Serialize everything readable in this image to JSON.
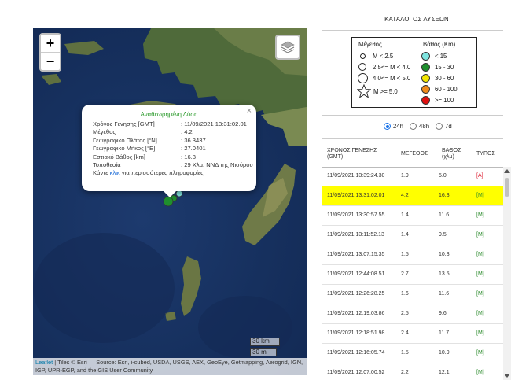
{
  "catalog_title": "ΚΑΤΑΛΟΓΟΣ ΛΥΣΕΩΝ",
  "map": {
    "zoom_in": "+",
    "zoom_out": "−",
    "scale_km": "30 km",
    "scale_mi": "30 mi",
    "attribution_leaflet": "Leaflet",
    "attribution_text": " | Tiles © Esri — Source: Esri, i-cubed, USDA, USGS, AEX, GeoEye, Getmapping, Aerogrid, IGN, IGP, UPR-EGP, and the GIS User Community"
  },
  "popup": {
    "title": "Αναθεωρημένη Λύση",
    "close": "×",
    "fields": [
      {
        "k": "Χρόνος Γένησης [GMT]",
        "v": ": 11/09/2021 13:31:02.01"
      },
      {
        "k": "Μέγεθος",
        "v": ": 4.2"
      },
      {
        "k": "Γεωγραφικό Πλάτος [°N]",
        "v": ": 36.3437"
      },
      {
        "k": "Γεωγραφικό Μήκος [°E]",
        "v": ": 27.0401"
      },
      {
        "k": "Εστιακό Βάθος [km]",
        "v": ": 16.3"
      },
      {
        "k": "Τοποθεσία",
        "v": ": 29 Χλμ. ΝΝΔ της Νισύρου"
      }
    ],
    "more_pre": "Κάντε ",
    "more_link": "κλικ",
    "more_post": " για περισσότερες πληροφορίες"
  },
  "legend": {
    "mag_header": "Μέγεθος",
    "mag_items": [
      "M < 2.5",
      "2.5<= M < 4.0",
      "4.0<= M < 5.0",
      "M >= 5.0"
    ],
    "depth_header": "Βάθος (Km)",
    "depth_items": [
      {
        "label": "< 15",
        "color": "#7fe5e0"
      },
      {
        "label": "15 - 30",
        "color": "#1f8f2e"
      },
      {
        "label": "30 - 60",
        "color": "#f2e600"
      },
      {
        "label": "60 - 100",
        "color": "#f08a1a"
      },
      {
        "label": ">= 100",
        "color": "#e01010"
      }
    ]
  },
  "filters": {
    "opt1": "24h",
    "opt2": "48h",
    "opt3": "7d",
    "selected": "24h"
  },
  "table": {
    "headers": {
      "time_l1": "ΧΡΟΝΟΣ ΓΕΝΕΣΗΣ",
      "time_l2": "(GMT)",
      "mag": "ΜΕΓΕΘΟΣ",
      "depth_l1": "ΒΑΘΟΣ",
      "depth_l2": "(χλμ)",
      "type": "ΤΥΠΟΣ"
    },
    "rows": [
      {
        "time": "11/09/2021 13:39:24.30",
        "mag": "1.9",
        "depth": "5.0",
        "type": "[A]"
      },
      {
        "time": "11/09/2021 13:31:02.01",
        "mag": "4.2",
        "depth": "16.3",
        "type": "[M]"
      },
      {
        "time": "11/09/2021 13:30:57.55",
        "mag": "1.4",
        "depth": "11.6",
        "type": "[M]"
      },
      {
        "time": "11/09/2021 13:11:52.13",
        "mag": "1.4",
        "depth": "9.5",
        "type": "[M]"
      },
      {
        "time": "11/09/2021 13:07:15.35",
        "mag": "1.5",
        "depth": "10.3",
        "type": "[M]"
      },
      {
        "time": "11/09/2021 12:44:08.51",
        "mag": "2.7",
        "depth": "13.5",
        "type": "[M]"
      },
      {
        "time": "11/09/2021 12:26:28.25",
        "mag": "1.6",
        "depth": "11.6",
        "type": "[M]"
      },
      {
        "time": "11/09/2021 12:19:03.86",
        "mag": "2.5",
        "depth": "9.6",
        "type": "[M]"
      },
      {
        "time": "11/09/2021 12:18:51.98",
        "mag": "2.4",
        "depth": "11.7",
        "type": "[M]"
      },
      {
        "time": "11/09/2021 12:16:05.74",
        "mag": "1.5",
        "depth": "10.9",
        "type": "[M]"
      },
      {
        "time": "11/09/2021 12:07:00.52",
        "mag": "2.2",
        "depth": "12.1",
        "type": "[M]"
      }
    ],
    "selected_index": 1
  }
}
